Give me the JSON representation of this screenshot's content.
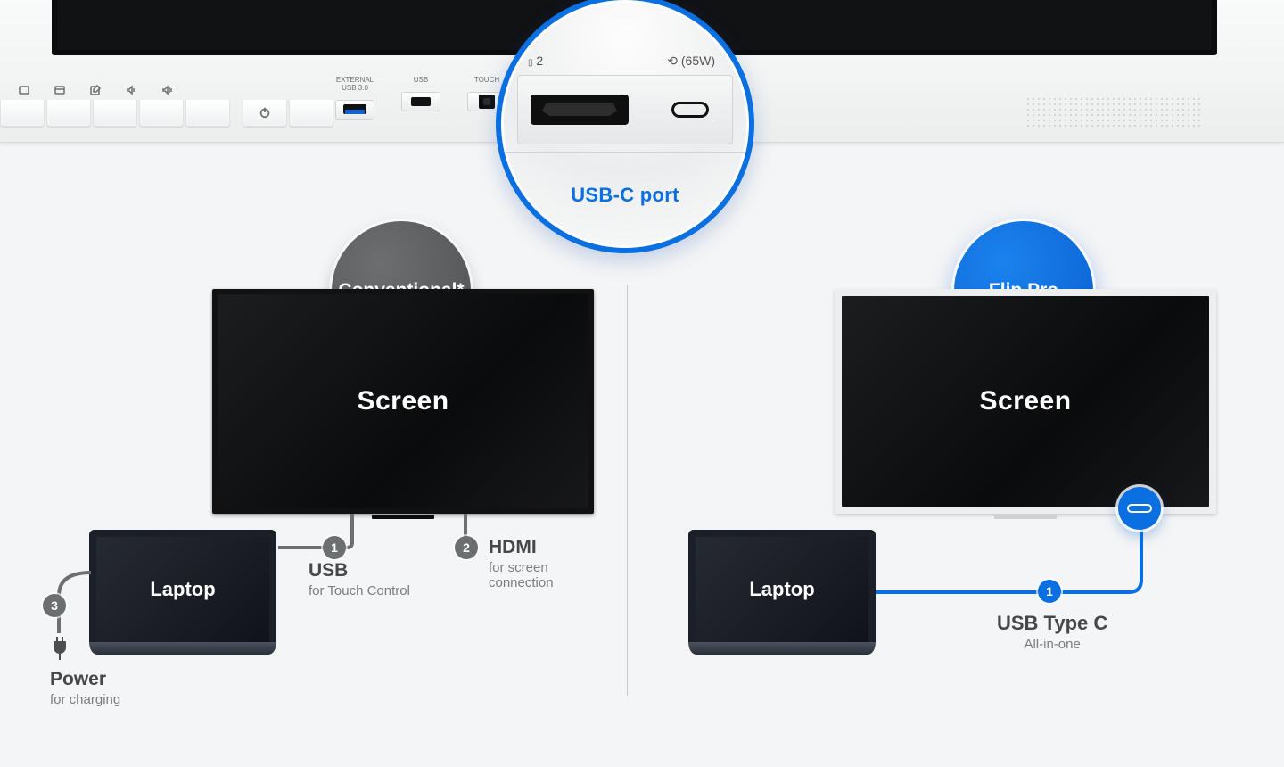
{
  "top": {
    "port_labels": {
      "external_usb": "EXTERNAL\nUSB 3.0",
      "usb": "USB",
      "touch": "TOUCH"
    },
    "mag_annot_left": "2",
    "mag_annot_right": "(65W)",
    "usbc_label": "USB-C port"
  },
  "left": {
    "badge": "Conventional*",
    "screen_label": "Screen",
    "laptop_label": "Laptop",
    "steps": {
      "usb": {
        "num": "1",
        "title": "USB",
        "sub": "for Touch Control"
      },
      "hdmi": {
        "num": "2",
        "title": "HDMI",
        "sub": "for screen\nconnection"
      },
      "power": {
        "num": "3",
        "title": "Power",
        "sub": "for charging"
      }
    }
  },
  "right": {
    "badge": "Flip Pro",
    "screen_label": "Screen",
    "laptop_label": "Laptop",
    "step": {
      "num": "1",
      "title": "USB Type C",
      "sub": "All-in-one"
    }
  }
}
